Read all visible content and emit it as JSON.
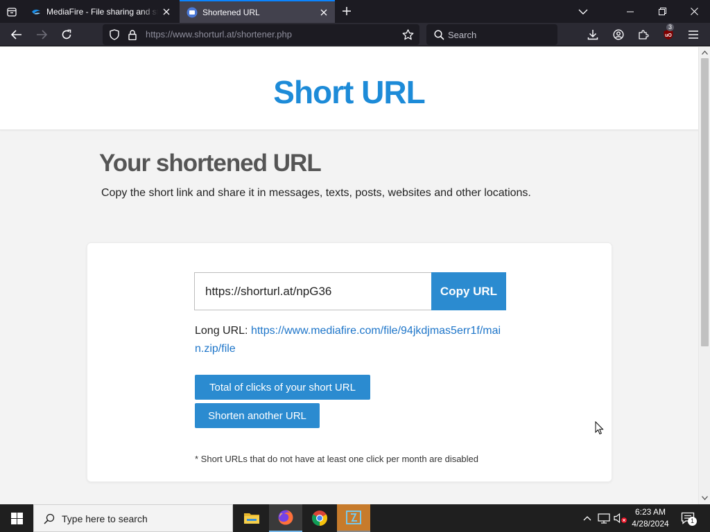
{
  "browser": {
    "tabs": [
      {
        "label": "MediaFire - File sharing and storage",
        "active": false,
        "favicon": "mediafire-icon"
      },
      {
        "label": "Shortened URL",
        "active": true,
        "favicon": "shorturl-icon"
      }
    ],
    "address": "https://www.shorturl.at/shortener.php",
    "search_placeholder": "Search",
    "extension_badge": "3"
  },
  "page": {
    "site_title": "Short URL",
    "heading": "Your shortened URL",
    "subtitle": "Copy the short link and share it in messages, texts, posts, websites and other locations.",
    "short_url": "https://shorturl.at/npG36",
    "copy_button": "Copy URL",
    "long_url_label": "Long URL:",
    "long_url": "https://www.mediafire.com/file/94jkdjmas5err1f/main.zip/file",
    "clicks_button": "Total of clicks of your short URL",
    "another_button": "Shorten another URL",
    "footnote": "* Short URLs that do not have at least one click per month are disabled"
  },
  "taskbar": {
    "search_placeholder": "Type here to search",
    "apps": [
      "file-explorer-icon",
      "firefox-icon",
      "chrome-icon",
      "app-icon"
    ],
    "time": "6:23 AM",
    "date": "4/28/2024",
    "notification_count": "1"
  },
  "colors": {
    "brand": "#1d8bd8",
    "button": "#2b8bd0",
    "link": "#1d75c9",
    "chrome_dark": "#1c1b22",
    "tab_active_accent": "#0a84ff"
  }
}
